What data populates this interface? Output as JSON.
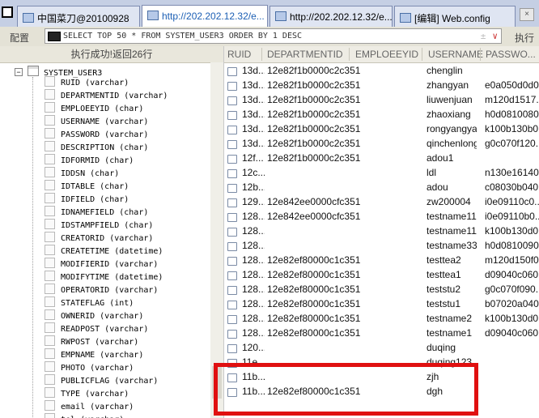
{
  "tabs": [
    {
      "label": "中国菜刀@20100928"
    },
    {
      "label": "http://202.202.12.32/e..."
    },
    {
      "label": "http://202.202.12.32/e..."
    },
    {
      "label": "[编辑] Web.config"
    }
  ],
  "toolbar": {
    "config_label": "配置",
    "sql_text": "SELECT TOP 50 * FROM SYSTEM_USER3 ORDER BY 1 DESC",
    "execute_label": "执行",
    "arrows": "±",
    "dropdown": "∨"
  },
  "status": "执行成功!返回26行",
  "tree": {
    "table_name": "SYSTEM_USER3",
    "columns": [
      "RUID (varchar)",
      "DEPARTMENTID (varchar)",
      "EMPLOEEYID (char)",
      "USERNAME (varchar)",
      "PASSWORD (varchar)",
      "DESCRIPTION (char)",
      "IDFORMID (char)",
      "IDDSN (char)",
      "IDTABLE (char)",
      "IDFIELD (char)",
      "IDNAMEFIELD (char)",
      "IDSTAMPFIELD (char)",
      "CREATORID (varchar)",
      "CREATETIME (datetime)",
      "MODIFIERID (varchar)",
      "MODIFYTIME (datetime)",
      "OPERATORID (varchar)",
      "STATEFLAG (int)",
      "OWNERID (varchar)",
      "READPOST (varchar)",
      "RWPOST (varchar)",
      "EMPNAME (varchar)",
      "PHOTO (varchar)",
      "PUBLICFLAG (varchar)",
      "TYPE (varchar)",
      "email (varchar)",
      "tel (varchar)"
    ]
  },
  "grid": {
    "headers": [
      "RUID",
      "DEPARTMENTID",
      "EMPLOEEYID",
      "USERNAME",
      "PASSWO..."
    ],
    "rows": [
      [
        "13d...",
        "12e82f1b0000c2c351",
        "chenglin",
        ""
      ],
      [
        "13d...",
        "12e82f1b0000c2c351",
        "zhangyan",
        "e0a050d0d0..."
      ],
      [
        "13d...",
        "12e82f1b0000c2c351",
        "liuwenjuan",
        "m120d1517..."
      ],
      [
        "13d...",
        "12e82f1b0000c2c351",
        "zhaoxiang",
        "h0d0810080..."
      ],
      [
        "13d...",
        "12e82f1b0000c2c351",
        "rongyangyang",
        "k100b130b0..."
      ],
      [
        "13d...",
        "12e82f1b0000c2c351",
        "qinchenlong",
        "g0c070f120..."
      ],
      [
        "12f...",
        "12e82f1b0000c2c351",
        "adou1",
        ""
      ],
      [
        "12c...",
        "",
        "ldl",
        "n130e16140..."
      ],
      [
        "12b...",
        "",
        "adou",
        "c08030b040..."
      ],
      [
        "129...",
        "12e842ee0000cfc351",
        "zw200004",
        "i0e09110c0..."
      ],
      [
        "128...",
        "12e842ee0000cfc351",
        "testname112",
        "i0e09110b0..."
      ],
      [
        "128...",
        "",
        "testname111",
        "k100b130d0..."
      ],
      [
        "128...",
        "",
        "testname33",
        "h0d0810090..."
      ],
      [
        "128...",
        "12e82ef80000c1c351",
        "testtea2",
        "m120d150f0..."
      ],
      [
        "128...",
        "12e82ef80000c1c351",
        "testtea1",
        "d09040c060..."
      ],
      [
        "128...",
        "12e82ef80000c1c351",
        "teststu2",
        "g0c070f090..."
      ],
      [
        "128...",
        "12e82ef80000c1c351",
        "teststu1",
        "b07020a040..."
      ],
      [
        "128...",
        "12e82ef80000c1c351",
        "testname2",
        "k100b130d0..."
      ],
      [
        "128...",
        "12e82ef80000c1c351",
        "testname1",
        "d09040c060..."
      ],
      [
        "120...",
        "",
        "duqing",
        ""
      ],
      [
        "11e...",
        "",
        "duqing123",
        ""
      ],
      [
        "11b...",
        "",
        "zjh",
        ""
      ],
      [
        "11b...",
        "12e82ef80000c1c351",
        "dgh",
        ""
      ]
    ]
  },
  "colors": {
    "highlight": "#e01010",
    "active_tab_text": "#1c5fb4"
  }
}
